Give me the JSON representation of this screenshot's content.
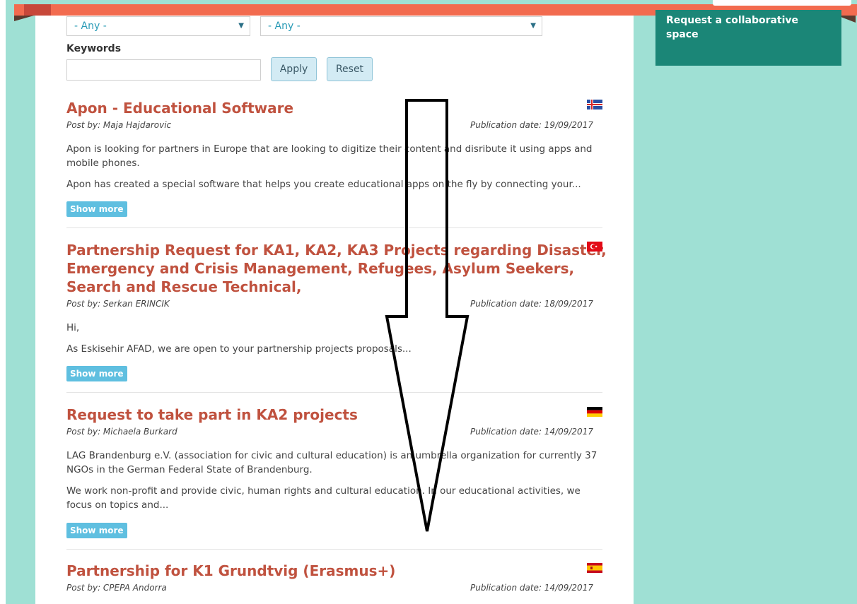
{
  "sidebar": {
    "request_space_label": "Request a collaborative space"
  },
  "filters": {
    "select1_value": "- Any -",
    "select2_value": "- Any -",
    "keywords_label": "Keywords",
    "keywords_value": "",
    "apply_label": "Apply",
    "reset_label": "Reset"
  },
  "posts": [
    {
      "title_lines": [
        "Apon - Educational Software"
      ],
      "byline": "Post by: Maja Hajdarovic",
      "date": "Publication date: 19/09/2017",
      "paragraphs": [
        "Apon is looking for partners in Europe that are looking to digitize their content and disribute it using apps and mobile phones.",
        "Apon has created a special software that helps you create educational apps on the fly by connecting your..."
      ],
      "show_more": "Show more",
      "flag": "iceland"
    },
    {
      "title_lines": [
        "Partnership Request for KA1, KA2, KA3 Projects regarding Disaster,",
        "Emergency and Crisis Management, Refugees, Asylum Seekers,",
        "Search and Rescue Technical,"
      ],
      "byline": "Post by: Serkan ERINCIK",
      "date": "Publication date: 18/09/2017",
      "paragraphs": [
        "Hi,",
        "As Eskisehir AFAD, we are open to your partnership projects proposals..."
      ],
      "show_more": "Show more",
      "flag": "turkey"
    },
    {
      "title_lines": [
        "Request to take part in KA2 projects"
      ],
      "byline": "Post by: Michaela Burkard",
      "date": "Publication date: 14/09/2017",
      "paragraphs": [
        "LAG Brandenburg e.V. (association for civic and cultural education) is an umbrella organization for currently 37 NGOs in the German Federal State of Brandenburg.",
        "We work non-profit and provide civic, human rights and cultural education. In our educational activities, we focus on topics and..."
      ],
      "show_more": "Show more",
      "flag": "germany"
    },
    {
      "title_lines": [
        "Partnership for K1 Grundtvig (Erasmus+)"
      ],
      "byline": "Post by: CPEPA Andorra",
      "date": "Publication date: 14/09/2017",
      "paragraphs": [],
      "show_more": "",
      "flag": "spain"
    }
  ],
  "colors": {
    "accent": "#c0523f",
    "background": "#9fe0d4",
    "topbar": "#f26b4f",
    "sidebar": "#1b8677"
  }
}
